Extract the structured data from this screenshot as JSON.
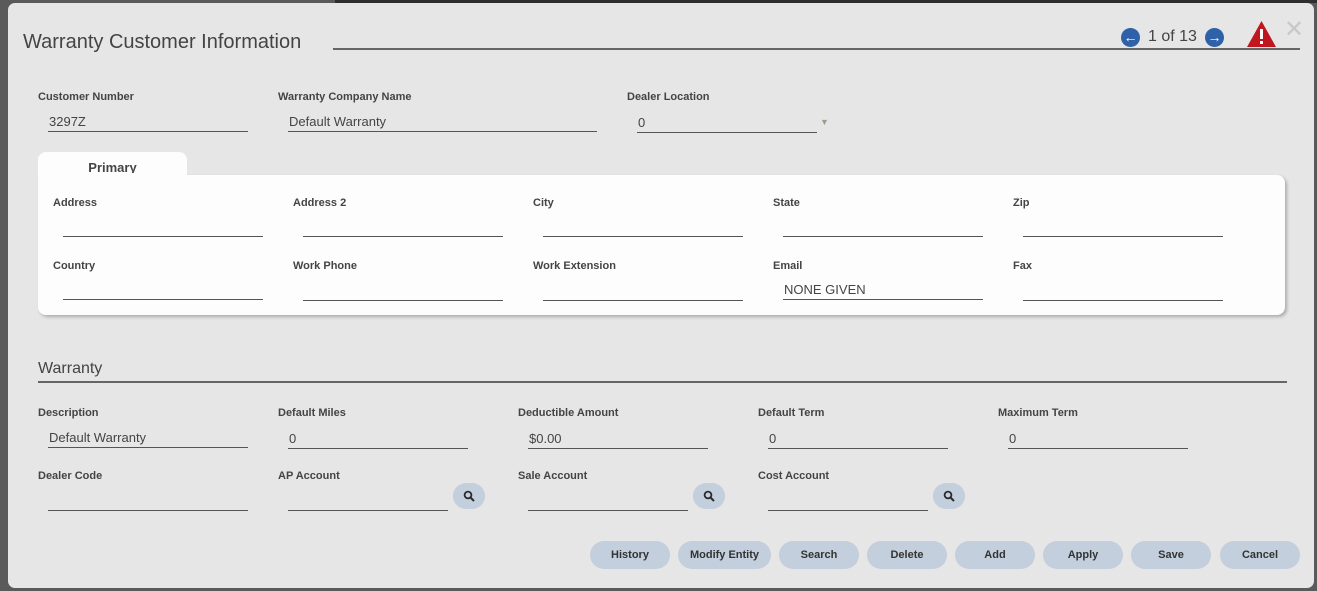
{
  "dialog": {
    "title": "Warranty Customer Information",
    "record_position": "1 of 13",
    "prev_icon": "arrow-left-circle-icon",
    "next_icon": "arrow-right-circle-icon",
    "warning_icon": "warning-triangle-icon",
    "close_icon": "close-icon"
  },
  "header_fields": {
    "customer_number": {
      "label": "Customer Number",
      "value": "3297Z"
    },
    "warranty_company_name": {
      "label": "Warranty Company Name",
      "value": "Default Warranty"
    },
    "dealer_location": {
      "label": "Dealer Location",
      "value": "0"
    }
  },
  "primary": {
    "tab_label": "Primary",
    "address": {
      "label": "Address",
      "value": ""
    },
    "address2": {
      "label": "Address 2",
      "value": ""
    },
    "city": {
      "label": "City",
      "value": ""
    },
    "state": {
      "label": "State",
      "value": ""
    },
    "zip": {
      "label": "Zip",
      "value": ""
    },
    "country": {
      "label": "Country",
      "value": ""
    },
    "work_phone": {
      "label": "Work Phone",
      "value": ""
    },
    "work_extension": {
      "label": "Work Extension",
      "value": ""
    },
    "email": {
      "label": "Email",
      "value": "NONE GIVEN"
    },
    "fax": {
      "label": "Fax",
      "value": ""
    }
  },
  "warranty": {
    "section_title": "Warranty",
    "description": {
      "label": "Description",
      "value": "Default Warranty"
    },
    "default_miles": {
      "label": "Default Miles",
      "value": "0"
    },
    "deductible_amount": {
      "label": "Deductible Amount",
      "value": "$0.00"
    },
    "default_term": {
      "label": "Default Term",
      "value": "0"
    },
    "maximum_term": {
      "label": "Maximum Term",
      "value": "0"
    },
    "dealer_code": {
      "label": "Dealer Code",
      "value": ""
    },
    "ap_account": {
      "label": "AP Account",
      "value": ""
    },
    "sale_account": {
      "label": "Sale Account",
      "value": ""
    },
    "cost_account": {
      "label": "Cost Account",
      "value": ""
    }
  },
  "buttons": {
    "history": "History",
    "modify_entity": "Modify Entity",
    "search": "Search",
    "delete": "Delete",
    "add": "Add",
    "apply": "Apply",
    "save": "Save",
    "cancel": "Cancel"
  },
  "colors": {
    "accent": "#2f61a8",
    "warning": "#c0161d",
    "button_bg": "#c3cfdc"
  }
}
